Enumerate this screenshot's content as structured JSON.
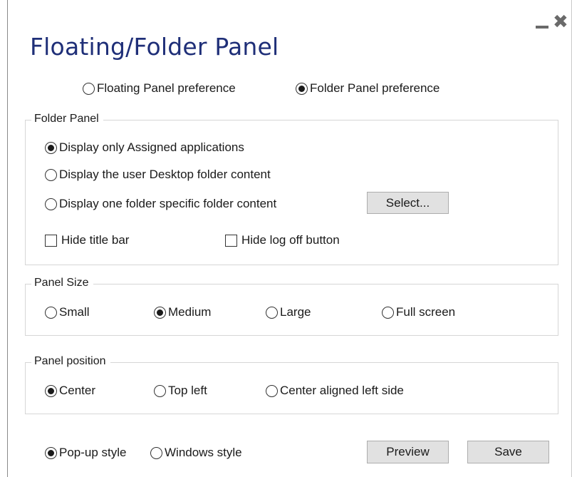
{
  "window": {
    "title": "Floating/Folder Panel",
    "minimize_icon": "minimize-icon",
    "close_icon": "close-icon",
    "close_glyph": "✖"
  },
  "preference": {
    "options": [
      {
        "label": "Floating Panel preference",
        "selected": false
      },
      {
        "label": "Folder Panel preference",
        "selected": true
      }
    ]
  },
  "folder_panel": {
    "legend": "Folder Panel",
    "options": [
      {
        "label": "Display only Assigned applications",
        "selected": true
      },
      {
        "label": "Display the user Desktop folder content",
        "selected": false
      },
      {
        "label": "Display one folder specific folder content",
        "selected": false
      }
    ],
    "select_button": "Select...",
    "hide_title_bar": {
      "label": "Hide title bar",
      "checked": false
    },
    "hide_logoff": {
      "label": "Hide log off button",
      "checked": false
    }
  },
  "panel_size": {
    "legend": "Panel Size",
    "options": [
      {
        "label": "Small",
        "selected": false
      },
      {
        "label": "Medium",
        "selected": true
      },
      {
        "label": "Large",
        "selected": false
      },
      {
        "label": "Full screen",
        "selected": false
      }
    ]
  },
  "panel_position": {
    "legend": "Panel position",
    "options": [
      {
        "label": "Center",
        "selected": true
      },
      {
        "label": "Top left",
        "selected": false
      },
      {
        "label": "Center aligned left side",
        "selected": false
      }
    ]
  },
  "style": {
    "options": [
      {
        "label": "Pop-up style",
        "selected": true
      },
      {
        "label": "Windows style",
        "selected": false
      }
    ]
  },
  "buttons": {
    "preview": "Preview",
    "save": "Save"
  }
}
